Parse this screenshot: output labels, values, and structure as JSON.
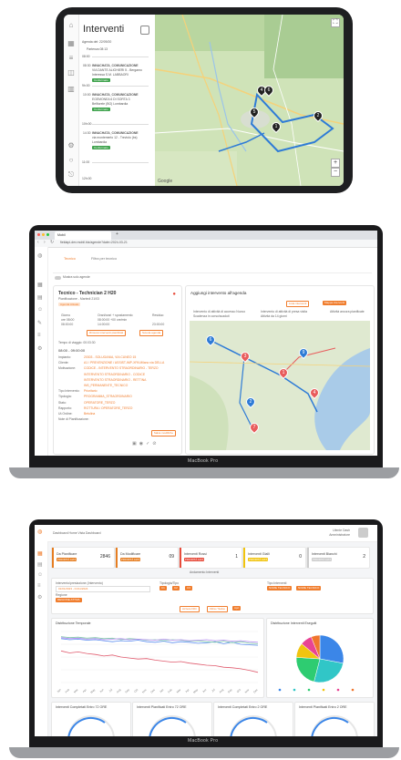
{
  "tablet": {
    "title": "Interventi",
    "agenda_label": "Agenda del: 22/09/20",
    "first_row": "Partenza 08:13",
    "slots": [
      "08:00",
      "9h:00",
      "10h:00",
      "11:00",
      "12h:00"
    ],
    "entries": [
      {
        "time": "08:30",
        "title": "INNACHATA_COMUNICAZIONE",
        "detail": "VIA DANTE ALIGHIERI 5 - Bergamo",
        "extra": "Interessa S.M. LABBAORI",
        "badge": "Confermato"
      },
      {
        "time": "10:00",
        "title": "INNACHATA_COMUNICAZIONE",
        "detail": "EGEMONEA 6 DI SORTA 3",
        "extra": "Belfiorele (BG) Lombardia",
        "badge": "Confermato"
      },
      {
        "time": "14:30",
        "title": "INNACHATA_COMUNICAZIONE",
        "detail": "via montemerlo 12 - Treviolo (bs)",
        "extra": "Lombardia",
        "badge": "Confermato"
      }
    ],
    "map_pins": [
      "4",
      "6",
      "5",
      "2",
      "1"
    ],
    "zoom_in": "+",
    "zoom_out": "−",
    "map_brand": "Google"
  },
  "laptop1": {
    "chin_label": "MacBook Pro",
    "url": "fieldapi-dev.mobil.biz/agende?date=2024-03-21",
    "tab_title": "Mobil",
    "tab_new": "+",
    "filter_tab_tecnico": "Tecnico",
    "filter_tab_filtra": "Filtra per tecnico",
    "toggle_label": "Mostra solo agende",
    "tech_card": {
      "title": "Tecnico - Technician 2 H20",
      "subtitle": "Pianificazione - Martedì 21/03",
      "badge": "Agenda Attuale",
      "cols": [
        {
          "label": "Giorno",
          "value1": "ore 08:00",
          "value2": "08:00:00"
        },
        {
          "label": "Orari/orari + spostamento",
          "value1": "08:00:00 +00 ore/min",
          "value2": "14:00:00"
        },
        {
          "label": "Residuo",
          "value1": "",
          "value2": "23:00:00"
        }
      ],
      "btn_remove": "Rimuovi interventi pianificati",
      "btn_clear": "Svuota agenda",
      "trip_label": "Tempo di viaggio: 00:03:30",
      "slot": "08:00 - 09:00:00",
      "fields": [
        {
          "k": "Impianto:",
          "v": "20303 - SOLUGANIA, VIA CUNEO 15"
        },
        {
          "k": "Cliente:",
          "v": "A1 / PREVENZIONE / ASSIST-IMP-XPA Milano via DELLA"
        },
        {
          "k": "Motivazione:",
          "v": "CODICE - INTERVENTO STRAORDINARIO - TERZO"
        },
        {
          "k": "",
          "v": "INTERVENTO STRAORDINARIO - CODICE"
        },
        {
          "k": "",
          "v": "INTERVENTO STRAORDINARIO - RETTINA"
        },
        {
          "k": "",
          "v": "INS_PERMANENTE_TECNICO"
        },
        {
          "k": "Tipo Intervento:",
          "v": "Prioritario"
        },
        {
          "k": "Tipologia:",
          "v": "PROGRAMMA_STRAORDINARIO"
        },
        {
          "k": "Stato:",
          "v": "OPERATORE_TERZO"
        },
        {
          "k": "Rapporto:",
          "v": "ROTTURA / OPERATORE_TERZO"
        },
        {
          "k": "Ut.Ordine:",
          "v": "Betulina"
        },
        {
          "k": "Note di Pianificazione:",
          "v": ""
        }
      ],
      "btn_save": "Salva modifiche"
    },
    "map_card": {
      "title": "Aggiungi intervento all'agenda",
      "btn_list": "Lista interventi",
      "btn_map": "Mappa interventi",
      "legend": [
        "Intervento di attività di accesso Nuovo",
        "Intervento di attività di presa visita",
        "Attività ancora pianificate",
        "Scadenza in corso/scaduti",
        "Attività da 14 giorni"
      ],
      "pins": [
        "6",
        "3",
        "1",
        "2",
        "9",
        "4",
        "7"
      ]
    }
  },
  "laptop2": {
    "chin_label": "MacBook Pro",
    "breadcrumb": "Dashboard  Home  Vista  Dashboard",
    "user_name": "Utente Dash",
    "user_role": "Amministratore",
    "kpis": [
      {
        "label": "Da Pianificare",
        "sub": "PRIORITÀ ALTA",
        "value": "2846",
        "color": "#e67e22"
      },
      {
        "label": "Da Modificare",
        "sub": "PRIORITÀ ALTA",
        "value": "09",
        "color": "#e67e22"
      },
      {
        "label": "Interventi Rossi",
        "sub": "PRIORITÀ ALTA",
        "value": "1",
        "color": "#e74c3c"
      },
      {
        "label": "Interventi Gialli",
        "sub": "PRIORITÀ ALTA",
        "value": "0",
        "color": "#f1c40f"
      },
      {
        "label": "Interventi Bianchi",
        "sub": "PRIORITÀ ALTA",
        "value": "2",
        "color": "#cccccc"
      }
    ],
    "section_title": "Andamento Interventi",
    "filters": {
      "intervention_label": "Intervento/prestazione (Intervento)",
      "date_value": "01/01/2023 - 01/11/2024",
      "type_label": "Tipologia/Tipo",
      "type_chips": [
        "C1",
        "C2",
        "C3"
      ],
      "tech_label": "Tipo Interventi",
      "tech_chips": [
        "NOME TECNICO",
        "NOME TECNICO"
      ],
      "region_label": "Regione",
      "region_chip": "REGIONE ATTIVA",
      "btn_a": "Azzera Filtri",
      "btn_b": "Filtra / Salva",
      "btn_c": "Apri"
    },
    "line_panel_title": "Distribuzione Temporale",
    "pie_panel_title": "Distribuzione Interventi Eseguiti",
    "bottom_panels": [
      "Interventi Completati Entro 72 ORE",
      "Interventi Pianificati Entro 72 ORE",
      "Interventi Completati Entro 2 ORE",
      "Interventi Pianificati Entro 2 ORE"
    ]
  },
  "chart_data": [
    {
      "type": "line",
      "title": "Distribuzione Temporale",
      "x": [
        "Jan",
        "Feb",
        "Mar",
        "Apr",
        "May",
        "Jun",
        "Jul",
        "Aug",
        "Sep",
        "Oct",
        "Nov",
        "Dec",
        "Jan",
        "Feb",
        "Mar",
        "Apr",
        "May",
        "Jun",
        "Jul",
        "Aug",
        "Sep",
        "Oct",
        "Nov",
        "Dec"
      ],
      "series": [
        {
          "values": [
            62,
            58,
            60,
            57,
            55,
            52,
            54,
            50,
            48,
            46,
            47,
            44,
            42,
            40,
            41,
            38,
            36,
            34,
            33,
            30,
            29,
            27,
            24,
            20
          ],
          "color": "#e05a6d"
        },
        {
          "values": [
            86,
            84,
            85,
            83,
            84,
            82,
            80,
            82,
            81,
            83,
            80,
            79,
            81,
            78,
            80,
            79,
            77,
            78,
            80,
            76,
            79,
            75,
            74,
            73
          ],
          "color": "#5b8def"
        },
        {
          "values": [
            90,
            88,
            89,
            87,
            88,
            86,
            87,
            84,
            86,
            85,
            83,
            84,
            82,
            84,
            83,
            81,
            82,
            80,
            79,
            81,
            78,
            80,
            77,
            76
          ],
          "color": "#7ec9a8"
        },
        {
          "values": [
            88,
            86,
            87,
            85,
            86,
            84,
            85,
            86,
            84,
            85,
            84,
            83,
            85,
            83,
            84,
            82,
            83,
            84,
            82,
            83,
            81,
            82,
            80,
            79
          ],
          "color": "#b58df0"
        }
      ]
    },
    {
      "type": "pie",
      "title": "Distribuzione Interventi Eseguiti",
      "categories": [
        "A",
        "B",
        "C",
        "D",
        "E",
        "F"
      ],
      "values": [
        28,
        26,
        22,
        10,
        8,
        6
      ],
      "colors": [
        "#3b86e8",
        "#31c6c7",
        "#2ecc71",
        "#f1c40f",
        "#e84393",
        "#f0752d"
      ]
    }
  ]
}
